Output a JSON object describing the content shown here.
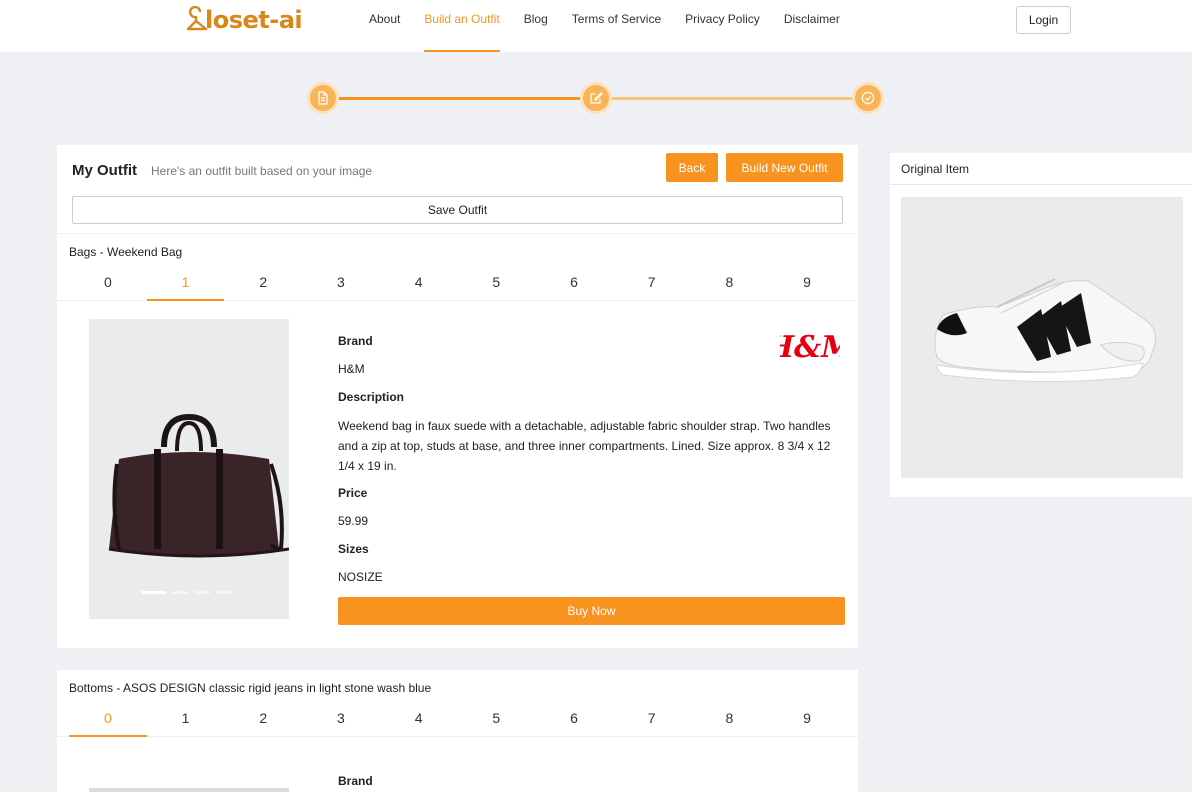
{
  "header": {
    "logo_text": "loset-ai",
    "nav": [
      {
        "label": "About",
        "active": false
      },
      {
        "label": "Build an Outfit",
        "active": true
      },
      {
        "label": "Blog",
        "active": false
      },
      {
        "label": "Terms of Service",
        "active": false
      },
      {
        "label": "Privacy Policy",
        "active": false
      },
      {
        "label": "Disclaimer",
        "active": false
      }
    ],
    "login_label": "Login"
  },
  "stepper": {
    "steps": [
      {
        "icon": "document-icon"
      },
      {
        "icon": "edit-icon"
      },
      {
        "icon": "check-circle-icon"
      }
    ]
  },
  "outfit": {
    "title": "My Outfit",
    "subtitle": "Here's an outfit built based on your image",
    "back_label": "Back",
    "new_label": "Build New Outfit",
    "save_label": "Save Outfit"
  },
  "categories": [
    {
      "title": "Bags - Weekend Bag",
      "tabs": [
        "0",
        "1",
        "2",
        "3",
        "4",
        "5",
        "6",
        "7",
        "8",
        "9"
      ],
      "active_tab": 1,
      "product": {
        "brand_label": "Brand",
        "brand": "H&M",
        "brand_logo_text": "H&M",
        "description_label": "Description",
        "description": "Weekend bag in faux suede with a detachable, adjustable fabric shoulder strap. Two handles and a zip at top, studs at base, and three inner compartments. Lined. Size approx. 8 3/4 x 12 1/4 x 19 in.",
        "price_label": "Price",
        "price": "59.99",
        "sizes_label": "Sizes",
        "sizes": "NOSIZE",
        "buy_label": "Buy Now",
        "carousel_count": 4,
        "carousel_active": 0
      }
    },
    {
      "title": "Bottoms - ASOS DESIGN classic rigid jeans in light stone wash blue",
      "tabs": [
        "0",
        "1",
        "2",
        "3",
        "4",
        "5",
        "6",
        "7",
        "8",
        "9"
      ],
      "active_tab": 0,
      "product": {
        "brand_label": "Brand"
      }
    }
  ],
  "original": {
    "title": "Original Item"
  },
  "colors": {
    "accent": "#f7931e",
    "background": "#eef0f3"
  }
}
